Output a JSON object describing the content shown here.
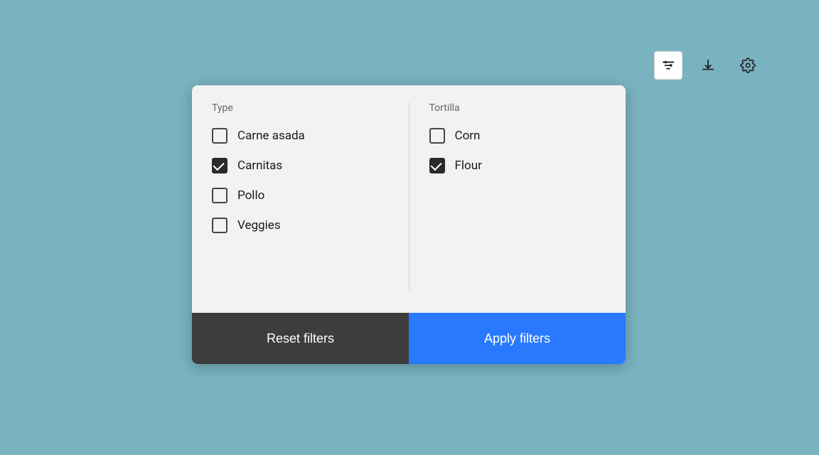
{
  "toolbar": {
    "filter_icon_label": "filter-icon",
    "download_icon_label": "download-icon",
    "settings_icon_label": "settings-icon"
  },
  "filter_panel": {
    "type_column": {
      "label": "Type",
      "options": [
        {
          "id": "carne-asada",
          "label": "Carne asada",
          "checked": false
        },
        {
          "id": "carnitas",
          "label": "Carnitas",
          "checked": true
        },
        {
          "id": "pollo",
          "label": "Pollo",
          "checked": false
        },
        {
          "id": "veggies",
          "label": "Veggies",
          "checked": false
        }
      ]
    },
    "tortilla_column": {
      "label": "Tortilla",
      "options": [
        {
          "id": "corn",
          "label": "Corn",
          "checked": false
        },
        {
          "id": "flour",
          "label": "Flour",
          "checked": true
        }
      ]
    },
    "reset_button_label": "Reset filters",
    "apply_button_label": "Apply filters"
  }
}
